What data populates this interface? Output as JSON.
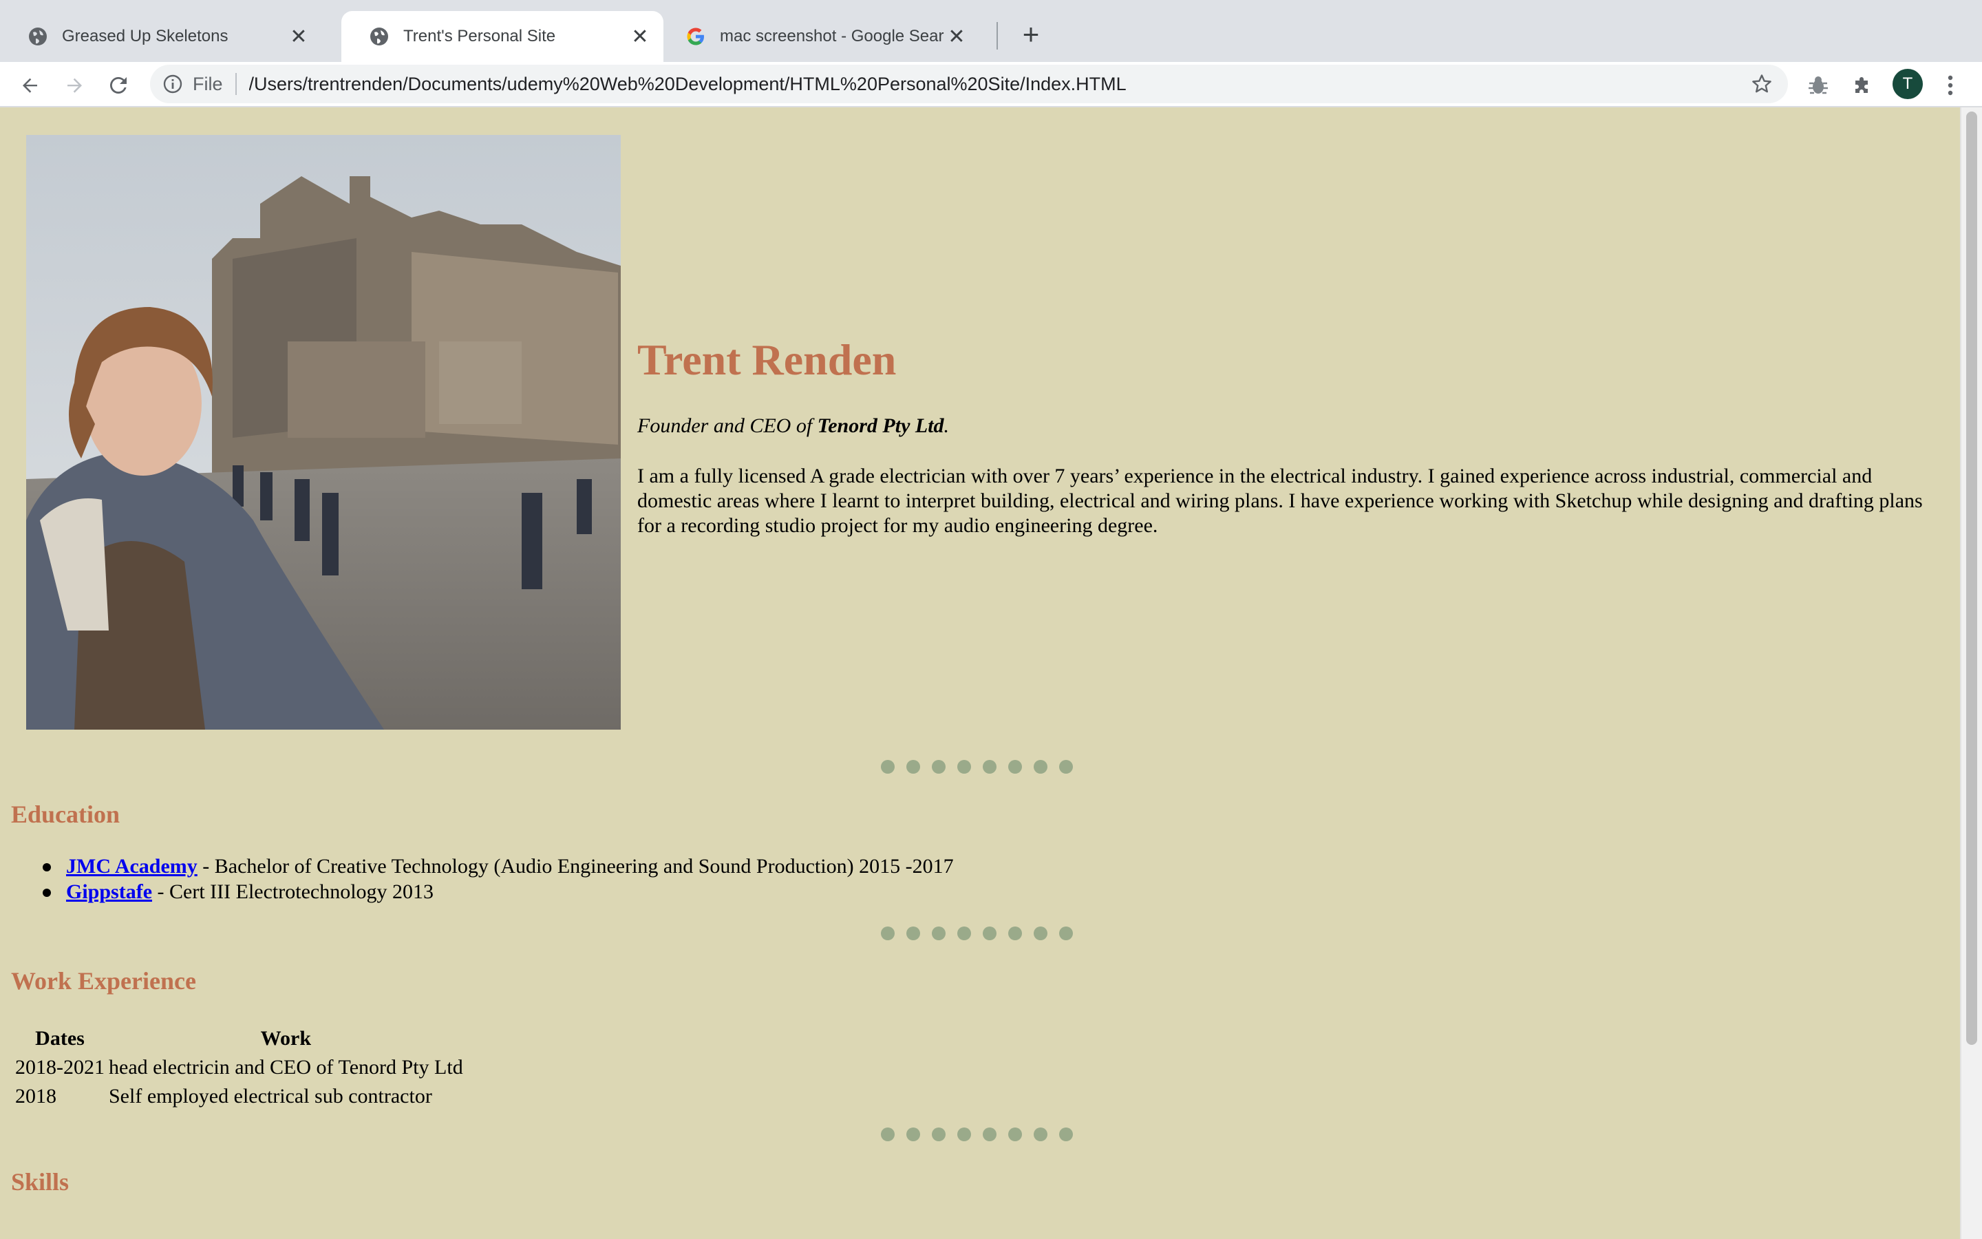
{
  "browser": {
    "tabs": [
      {
        "title": "Greased Up Skeletons",
        "icon": "globe-icon",
        "active": false
      },
      {
        "title": "Trent's Personal Site",
        "icon": "globe-icon",
        "active": true
      },
      {
        "title": "mac screenshot - Google Search",
        "icon": "google-icon",
        "active": false
      }
    ],
    "address": {
      "scheme_label": "File",
      "url": "/Users/trentrenden/Documents/udemy%20Web%20Development/HTML%20Personal%20Site/Index.HTML"
    },
    "profile_initial": "T"
  },
  "page": {
    "name": "Trent Renden",
    "tagline": {
      "prefix": "Founder and CEO of ",
      "company": "Tenord Pty Ltd",
      "suffix": "."
    },
    "bio": "I am a fully licensed A grade electrician with over 7 years’ experience in the electrical industry. I gained experience across industrial, commercial and domestic areas where I learnt to interpret building, electrical and wiring plans. I have experience working with Sketchup while designing and drafting plans for a recording studio project for my audio engineering degree.",
    "education": {
      "heading": "Education",
      "items": [
        {
          "link": "JMC Academy",
          "text": " - Bachelor of Creative Technology (Audio Engineering and Sound Production) 2015 -2017"
        },
        {
          "link": "Gippstafe",
          "text": " - Cert III Electrotechnology 2013"
        }
      ]
    },
    "work": {
      "heading": "Work Experience",
      "columns": [
        "Dates",
        "Work"
      ],
      "rows": [
        [
          "2018-2021",
          "head electricin and CEO of Tenord Pty Ltd"
        ],
        [
          "2018",
          "Self employed electrical sub contractor"
        ]
      ]
    },
    "skills": {
      "heading": "Skills"
    }
  },
  "colors": {
    "page_background": "#dcd7b4",
    "heading": "#c0714f",
    "dots": "#9aaa8a",
    "link": "#0000ee"
  }
}
